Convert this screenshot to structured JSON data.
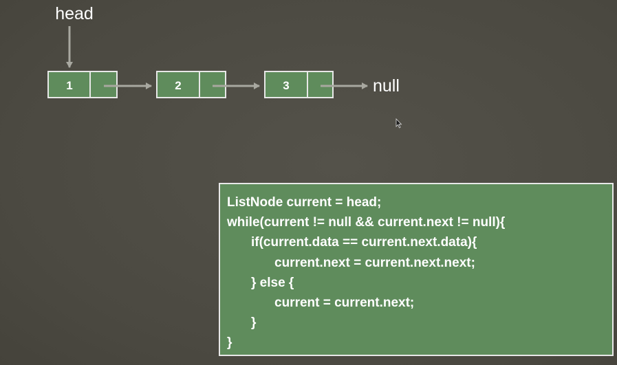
{
  "diagram": {
    "head_label": "head",
    "nodes": [
      {
        "data": "1"
      },
      {
        "data": "2"
      },
      {
        "data": "3"
      }
    ],
    "terminal_label": "null"
  },
  "code": {
    "lines": [
      {
        "text": "ListNode current = head;",
        "indent": 0
      },
      {
        "text": "while(current != null && current.next != null){",
        "indent": 0
      },
      {
        "text": "if(current.data == current.next.data){",
        "indent": 1
      },
      {
        "text": "current.next = current.next.next;",
        "indent": 2
      },
      {
        "text": "} else {",
        "indent": 1
      },
      {
        "text": "current = current.next;",
        "indent": 2
      },
      {
        "text": "}",
        "indent": 1
      },
      {
        "text": "}",
        "indent": 0
      }
    ]
  },
  "colors": {
    "background": "#4c4a42",
    "node_fill": "#5f8c5c",
    "node_border": "#e8e8e8",
    "arrow": "#a8a8a0",
    "text": "#ffffff"
  }
}
